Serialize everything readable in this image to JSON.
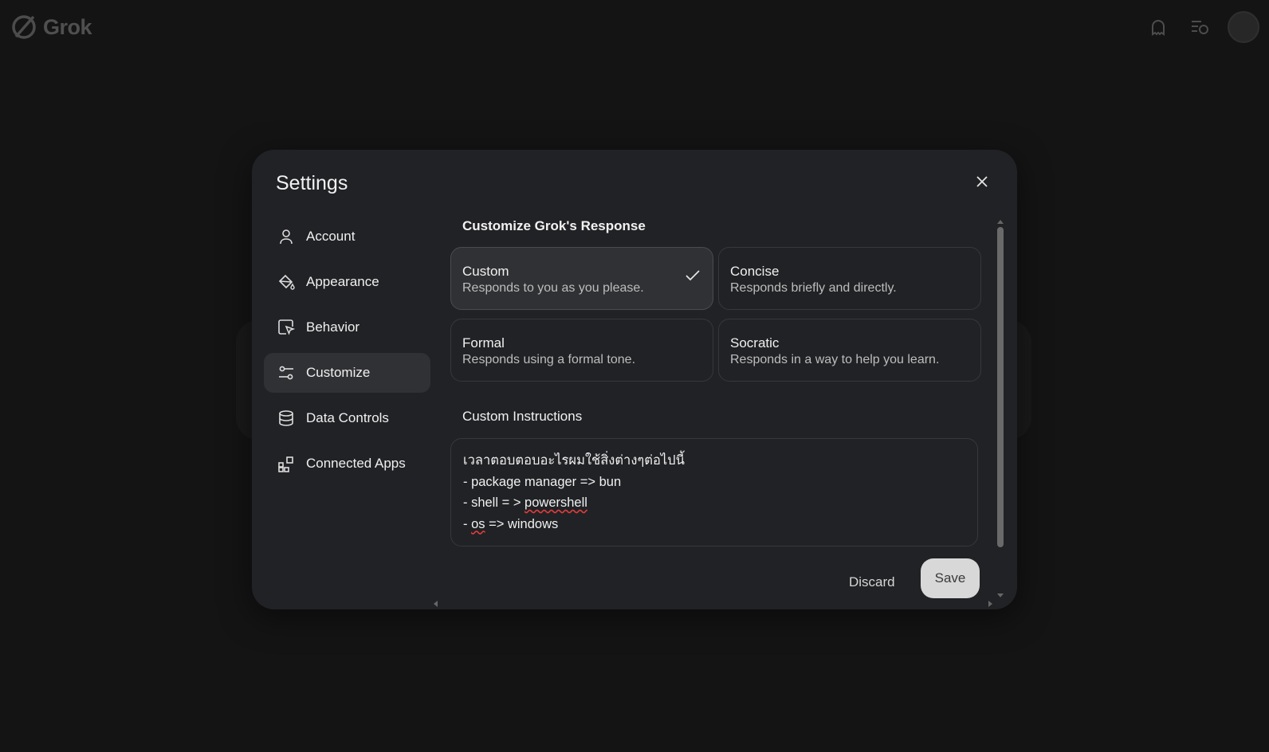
{
  "app": {
    "name": "Grok"
  },
  "colors": {
    "background": "#141414",
    "modal": "#212225",
    "selected": "#303134",
    "accent_button": "#d8d8d8",
    "spellcheck": "#e03c3c"
  },
  "topbar": {
    "icons": [
      "ghost-icon",
      "chat-history-icon",
      "avatar"
    ]
  },
  "settings": {
    "title": "Settings",
    "nav": [
      {
        "label": "Account",
        "icon": "user-icon",
        "active": false
      },
      {
        "label": "Appearance",
        "icon": "paint-bucket-icon",
        "active": false
      },
      {
        "label": "Behavior",
        "icon": "cursor-icon",
        "active": false
      },
      {
        "label": "Customize",
        "icon": "sliders-icon",
        "active": true
      },
      {
        "label": "Data Controls",
        "icon": "database-icon",
        "active": false
      },
      {
        "label": "Connected Apps",
        "icon": "apps-grid-icon",
        "active": false
      }
    ],
    "customize": {
      "response_title": "Customize Grok's Response",
      "options": [
        {
          "title": "Custom",
          "desc": "Responds to you as you please.",
          "selected": true
        },
        {
          "title": "Concise",
          "desc": "Responds briefly and directly.",
          "selected": false
        },
        {
          "title": "Formal",
          "desc": "Responds using a formal tone.",
          "selected": false
        },
        {
          "title": "Socratic",
          "desc": "Responds in a way to help you learn.",
          "selected": false
        }
      ],
      "instructions_title": "Custom Instructions",
      "instructions": {
        "line1": "เวลาตอบตอบอะไรผมใช้สิ่งต่างๆต่อไปนี้",
        "line2": "- package manager => bun",
        "line3_prefix": "- shell = > ",
        "line3_typo": "powershell",
        "line4_prefix": "- ",
        "line4_typo": "os",
        "line4_suffix": " => windows"
      },
      "discard_label": "Discard",
      "save_label": "Save"
    }
  }
}
